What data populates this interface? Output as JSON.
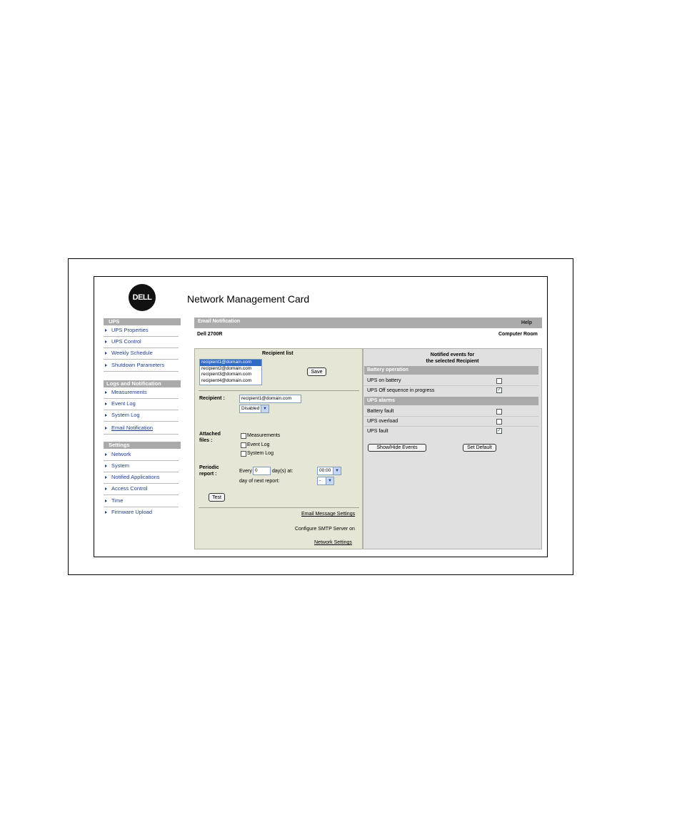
{
  "app": {
    "logo_text": "DELL",
    "title": "Network Management Card"
  },
  "sidebar": {
    "sections": [
      {
        "header": "UPS",
        "items": [
          "UPS Properties",
          "UPS Control",
          "Weekly Schedule",
          "Shutdown Parameters"
        ]
      },
      {
        "header": "Logs and Notification",
        "items": [
          "Measurements",
          "Event Log",
          "System Log",
          "Email Notification"
        ]
      },
      {
        "header": "Settings",
        "items": [
          "Network",
          "System",
          "Notified Applications",
          "Access Control",
          "Time",
          "Firmware Upload"
        ]
      }
    ],
    "active": "Email Notification"
  },
  "page": {
    "title": "Email Notification",
    "help": "Help",
    "device": "Dell 2700R",
    "location": "Computer Room"
  },
  "left_panel": {
    "recipient_list_title": "Recipient list",
    "recipients": [
      "recipient1@domain.com",
      "recipient2@domain.com",
      "recipient3@domain.com",
      "recipient4@domain.com"
    ],
    "selected_recipient": "recipient1@domain.com",
    "save_label": "Save",
    "recipient_label": "Recipient :",
    "recipient_value": "recipient1@domain.com",
    "status_value": "Disabled",
    "attached_label_1": "Attached",
    "attached_label_2": "files :",
    "attached_files": [
      "Measurements",
      "Event Log",
      "System Log"
    ],
    "periodic_label_1": "Periodic",
    "periodic_label_2": "report :",
    "every_label": "Every",
    "every_value": "0",
    "days_label": "day(s) at:",
    "time_value": "00:00",
    "next_report_label": "day of next report:",
    "next_report_value": "-",
    "test_label": "Test",
    "email_settings_link": "Email Message Settings",
    "smtp_text": "Configure SMTP Server on",
    "network_settings_link": "Network Settings"
  },
  "right_panel": {
    "title_line1": "Notified events for",
    "title_line2": "the selected Recipient",
    "groups": [
      {
        "header": "Battery operation",
        "events": [
          {
            "label": "UPS on battery",
            "checked": false
          },
          {
            "label": "UPS Off sequence in progress",
            "checked": true
          }
        ]
      },
      {
        "header": "UPS alarms",
        "events": [
          {
            "label": "Battery fault",
            "checked": false
          },
          {
            "label": "UPS overload",
            "checked": false
          },
          {
            "label": "UPS fault",
            "checked": true
          }
        ]
      }
    ],
    "show_hide_label": "Show/Hide Events",
    "set_default_label": "Set Default"
  }
}
